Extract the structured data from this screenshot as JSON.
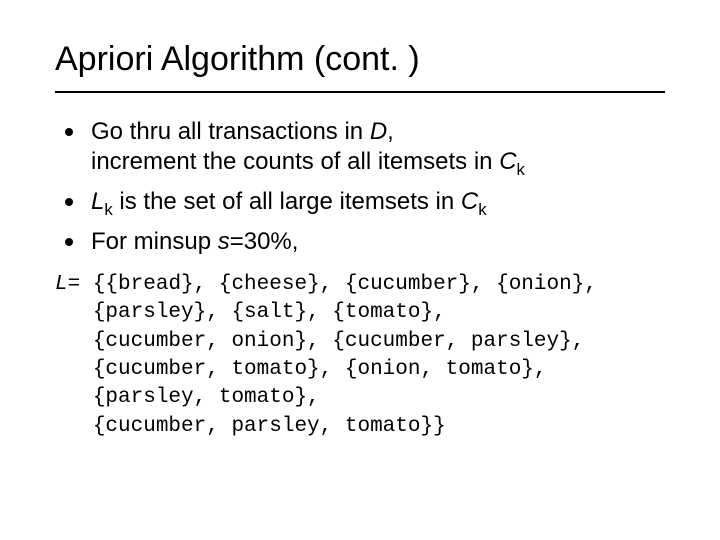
{
  "title": "Apriori Algorithm (cont. )",
  "bullets": {
    "b1": {
      "pre": "Go thru all transactions in ",
      "D": "D",
      "post1": ",",
      "line2_a": "increment the counts of all itemsets in ",
      "line2_C": "C",
      "line2_k": "k"
    },
    "b2": {
      "L": "L",
      "k1": "k",
      "mid": " is the set of all large itemsets in ",
      "C": "C",
      "k2": "k"
    },
    "b3": {
      "pre": "For minsup ",
      "s": "s",
      "post": "=30%,"
    }
  },
  "mono": {
    "lhs": "L",
    "eq": "= ",
    "l1": "{{bread}, {cheese}, {cucumber}, {onion},",
    "l2": " {parsley}, {salt}, {tomato},",
    "l3": " {cucumber, onion}, {cucumber, parsley},",
    "l4": " {cucumber, tomato}, {onion, tomato},",
    "l5": " {parsley, tomato},",
    "l6": " {cucumber, parsley, tomato}}"
  }
}
